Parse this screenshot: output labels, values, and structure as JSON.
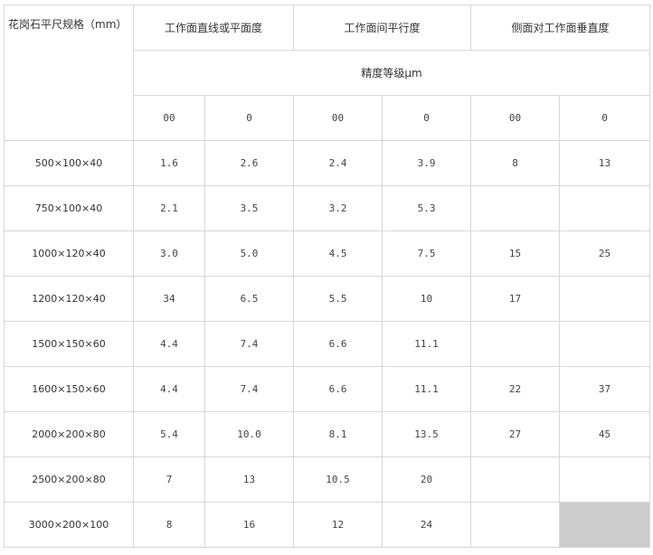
{
  "header": {
    "corner": "花岗石平尺规格（mm）",
    "groups": [
      "工作面直线或平面度",
      "工作面间平行度",
      "侧面对工作面垂直度"
    ],
    "precision": "精度等级μm",
    "grades": [
      "00",
      "0",
      "00",
      "0",
      "00",
      "0"
    ]
  },
  "rows": [
    {
      "size": "500×100×40",
      "cells": [
        "1.6",
        "2.6",
        "2.4",
        "3.9",
        "8",
        "13"
      ]
    },
    {
      "size": "750×100×40",
      "cells": [
        "2.1",
        "3.5",
        "3.2",
        "5.3",
        "",
        ""
      ]
    },
    {
      "size": "1000×120×40",
      "cells": [
        "3.0",
        "5.0",
        "4.5",
        "7.5",
        "15",
        "25"
      ]
    },
    {
      "size": "1200×120×40",
      "cells": [
        "34",
        "6.5",
        "5.5",
        "10",
        "17",
        ""
      ]
    },
    {
      "size": "1500×150×60",
      "cells": [
        "4.4",
        "7.4",
        "6.6",
        "11.1",
        "",
        ""
      ]
    },
    {
      "size": "1600×150×60",
      "cells": [
        "4.4",
        "7.4",
        "6.6",
        "11.1",
        "22",
        "37"
      ]
    },
    {
      "size": "2000×200×80",
      "cells": [
        "5.4",
        "10.0",
        "8.1",
        "13.5",
        "27",
        "45"
      ]
    },
    {
      "size": "2500×200×80",
      "cells": [
        "7",
        "13",
        "10.5",
        "20",
        "",
        ""
      ]
    },
    {
      "size": "3000×200×100",
      "cells": [
        "8",
        "16",
        "12",
        "24",
        "",
        ""
      ]
    }
  ],
  "colors": {
    "border": "#d8d8d8",
    "text": "#333333",
    "filled_cell": "#cccccc"
  }
}
